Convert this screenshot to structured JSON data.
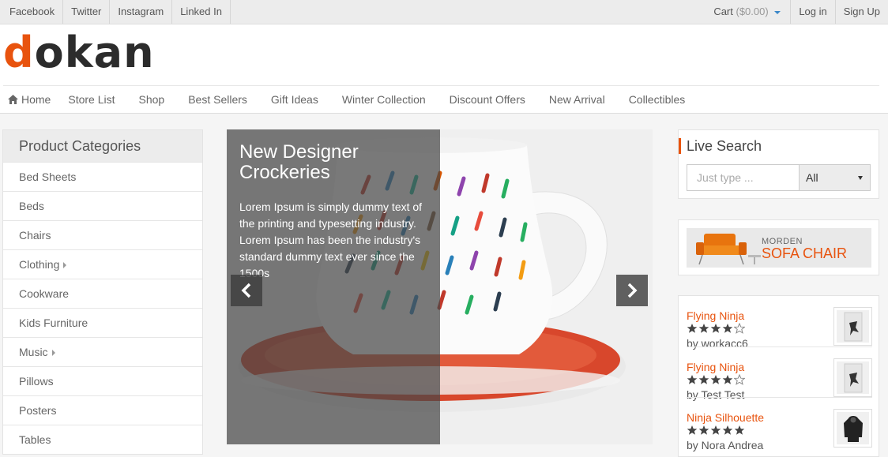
{
  "topbar": {
    "social": [
      "Facebook",
      "Twitter",
      "Instagram",
      "Linked In"
    ],
    "cart_label": "Cart",
    "cart_amount": "($0.00)",
    "login": "Log in",
    "signup": "Sign Up"
  },
  "brand": {
    "logo_first": "d",
    "logo_rest": "okan"
  },
  "nav": [
    "Home",
    "Store List",
    "Shop",
    "Best Sellers",
    "Gift Ideas",
    "Winter Collection",
    "Discount Offers",
    "New Arrival",
    "Collectibles"
  ],
  "categories": {
    "title": "Product Categories",
    "items": [
      {
        "label": "Bed Sheets",
        "sub": false
      },
      {
        "label": "Beds",
        "sub": false
      },
      {
        "label": "Chairs",
        "sub": false
      },
      {
        "label": "Clothing",
        "sub": true
      },
      {
        "label": "Cookware",
        "sub": false
      },
      {
        "label": "Kids Furniture",
        "sub": false
      },
      {
        "label": "Music",
        "sub": true
      },
      {
        "label": "Pillows",
        "sub": false
      },
      {
        "label": "Posters",
        "sub": false
      },
      {
        "label": "Tables",
        "sub": false
      }
    ]
  },
  "slider": {
    "title": "New Designer Crockeries",
    "text": "Lorem Ipsum is simply dummy text of the printing and typesetting industry. Lorem Ipsum has been the industry's standard dummy text ever since the 1500s"
  },
  "live_search": {
    "title": "Live Search",
    "placeholder": "Just type ...",
    "category": "All"
  },
  "banner": {
    "line1": "MORDEN",
    "line2": "SOFA CHAIR"
  },
  "products": [
    {
      "name": "Flying Ninja",
      "rating": 4,
      "by": "by workacc6"
    },
    {
      "name": "Flying Ninja",
      "rating": 4,
      "by": "by Test Test"
    },
    {
      "name": "Ninja Silhouette",
      "rating": 5,
      "by": "by Nora Andrea"
    }
  ],
  "colors": {
    "accent": "#e8530e",
    "text": "#555555",
    "topbar_bg": "#ececec"
  }
}
